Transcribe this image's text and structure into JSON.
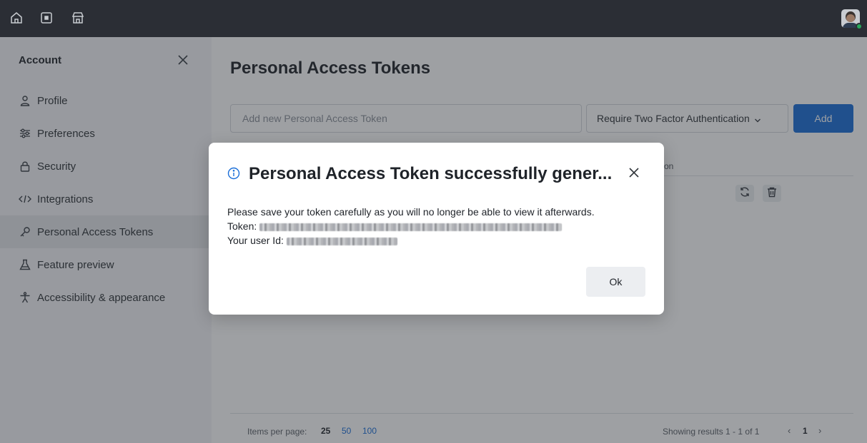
{
  "topbar": {
    "icons": [
      "home-icon",
      "board-icon",
      "marketplace-icon"
    ],
    "avatar": "user-avatar"
  },
  "sidebar": {
    "title": "Account",
    "items": [
      {
        "label": "Profile",
        "icon": "person-icon"
      },
      {
        "label": "Preferences",
        "icon": "sliders-icon"
      },
      {
        "label": "Security",
        "icon": "lock-icon"
      },
      {
        "label": "Integrations",
        "icon": "code-icon"
      },
      {
        "label": "Personal Access Tokens",
        "icon": "key-icon",
        "active": true
      },
      {
        "label": "Feature preview",
        "icon": "flask-icon"
      },
      {
        "label": "Accessibility & appearance",
        "icon": "accessibility-icon"
      }
    ]
  },
  "main": {
    "title": "Personal Access Tokens",
    "token_input": {
      "placeholder": "Add new Personal Access Token",
      "value": ""
    },
    "tfa_select": {
      "selected": "Require Two Factor Authentication"
    },
    "add_label": "Add",
    "column_header_fragment": "on",
    "pagination": {
      "items_per_page_label": "Items per page:",
      "options": [
        "25",
        "50",
        "100"
      ],
      "selected": "25",
      "showing": "Showing results 1 - 1 of 1",
      "prev": "‹",
      "current_page": "1",
      "next": "›"
    }
  },
  "modal": {
    "title": "Personal Access Token successfully gener...",
    "message": "Please save your token carefully as you will no longer be able to view it afterwards.",
    "token_label": "Token:",
    "user_id_label": "Your user Id:",
    "ok_label": "Ok"
  },
  "colors": {
    "topbar": "#2b2e35",
    "accent": "#1a6ed8",
    "sidebar_bg": "#f4f5f7",
    "overlay": "rgba(40,44,52,0.45)"
  }
}
